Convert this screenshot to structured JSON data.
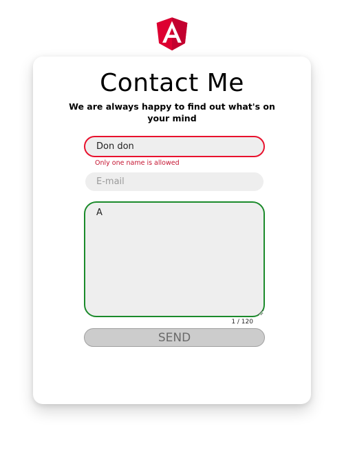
{
  "header": {
    "logo_icon": "angular-logo-icon",
    "logo_letter": "A",
    "logo_colors": {
      "primary": "#dd0031",
      "secondary": "#c3002f",
      "letter": "#ffffff"
    }
  },
  "card": {
    "title": "Contact Me",
    "subtitle": "We are always happy to find out what's on your mind"
  },
  "form": {
    "name": {
      "value": "Don don",
      "error": "Only one name is allowed",
      "border_color": "#e8112d"
    },
    "email": {
      "value": "",
      "placeholder": "E-mail"
    },
    "message": {
      "value": "A",
      "counter": "1 / 120",
      "border_color": "#1a8a2a"
    },
    "send_label": "SEND"
  }
}
